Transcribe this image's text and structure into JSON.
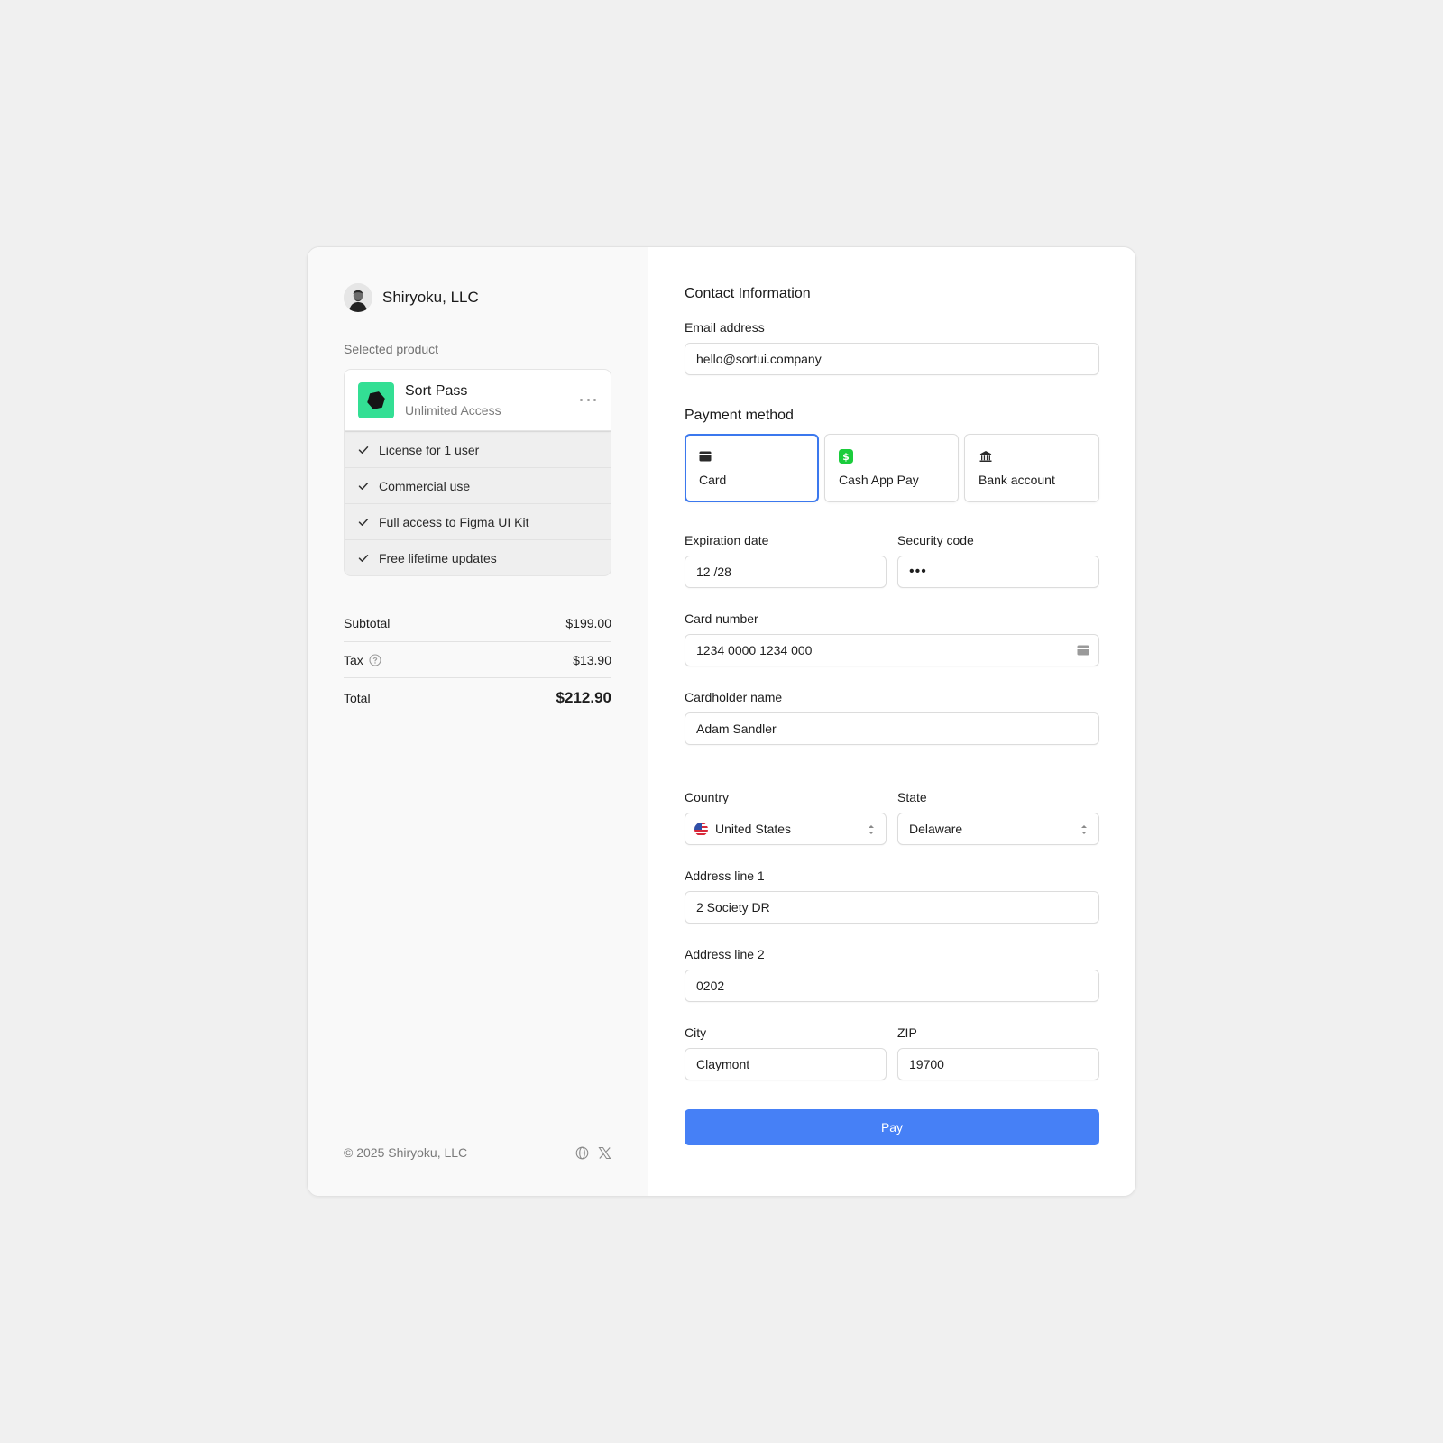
{
  "brand": {
    "name": "Shiryoku, LLC"
  },
  "order": {
    "section_label": "Selected product",
    "product": {
      "name": "Sort Pass",
      "subtitle": "Unlimited Access",
      "logo_color": "#33df94"
    },
    "features": [
      "License for 1 user",
      "Commercial use",
      "Full access to Figma UI Kit",
      "Free lifetime updates"
    ],
    "summary": {
      "subtotal_label": "Subtotal",
      "subtotal_value": "$199.00",
      "tax_label": "Tax",
      "tax_value": "$13.90",
      "total_label": "Total",
      "total_value": "$212.90"
    },
    "footer": {
      "copyright": "© 2025 Shiryoku, LLC",
      "icons": [
        "globe-icon",
        "x-logo-icon"
      ]
    }
  },
  "form": {
    "contact_title": "Contact Information",
    "email": {
      "label": "Email address",
      "value": "hello@sortui.company"
    },
    "payment_title": "Payment method",
    "methods": [
      {
        "label": "Card",
        "icon": "card-icon",
        "selected": true
      },
      {
        "label": "Cash App Pay",
        "icon": "cashapp-icon",
        "selected": false
      },
      {
        "label": "Bank account",
        "icon": "bank-icon",
        "selected": false
      }
    ],
    "expiration": {
      "label": "Expiration date",
      "value": "12 /28"
    },
    "security": {
      "label": "Security code",
      "value": "•••"
    },
    "card_number": {
      "label": "Card number",
      "value": "1234 0000 1234 000"
    },
    "cardholder": {
      "label": "Cardholder name",
      "value": "Adam Sandler"
    },
    "country": {
      "label": "Country",
      "value": "United States"
    },
    "state": {
      "label": "State",
      "value": "Delaware"
    },
    "address1": {
      "label": "Address line 1",
      "value": "2 Society DR"
    },
    "address2": {
      "label": "Address line 2",
      "value": "0202"
    },
    "city": {
      "label": "City",
      "value": "Claymont"
    },
    "zip": {
      "label": "ZIP",
      "value": "19700"
    },
    "pay_label": "Pay",
    "accent_color": "#4680f6"
  }
}
